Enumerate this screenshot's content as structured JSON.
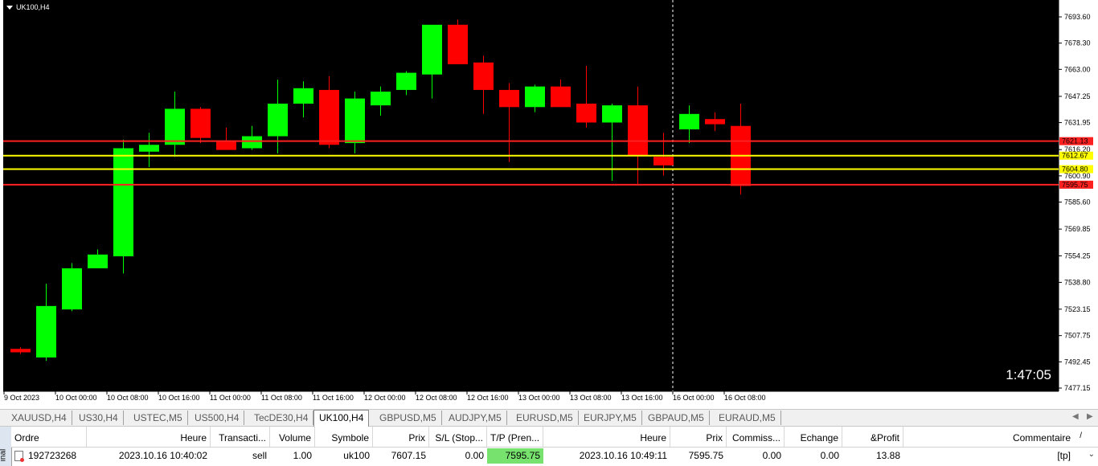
{
  "chart": {
    "symbol_timeframe": "UK100,H4",
    "countdown": "1:47:05",
    "colors": {
      "background": "#000000",
      "bull": "#00ff00",
      "bear": "#ff0000",
      "grid": "#ffffff",
      "level_red": "#ff2020",
      "level_yellow": "#ffff00"
    },
    "price_axis": [
      "7693.60",
      "7678.30",
      "7663.00",
      "7647.25",
      "7631.95",
      "7616.20",
      "7600.90",
      "7585.60",
      "7569.85",
      "7554.25",
      "7538.80",
      "7523.15",
      "7507.75",
      "7492.45",
      "7477.15"
    ],
    "time_axis": [
      "9 Oct 2023",
      "10 Oct 00:00",
      "10 Oct 08:00",
      "10 Oct 16:00",
      "11 Oct 00:00",
      "11 Oct 08:00",
      "11 Oct 16:00",
      "12 Oct 00:00",
      "12 Oct 08:00",
      "12 Oct 16:00",
      "13 Oct 00:00",
      "13 Oct 08:00",
      "13 Oct 16:00",
      "16 Oct 00:00",
      "16 Oct 08:00"
    ],
    "levels": [
      {
        "price": 7621.13,
        "label": "7621.13",
        "color": "#ff2020"
      },
      {
        "price": 7612.67,
        "label": "7612.67",
        "color": "#ffff00"
      },
      {
        "price": 7604.8,
        "label": "7604.80",
        "color": "#ffff00"
      },
      {
        "price": 7595.75,
        "label": "7595.75",
        "color": "#ff2020"
      }
    ],
    "candles": [
      {
        "o": 7500,
        "h": 7501,
        "c": 7498,
        "l": 7497
      },
      {
        "o": 7495,
        "h": 7538,
        "c": 7525,
        "l": 7493
      },
      {
        "o": 7523,
        "h": 7550,
        "c": 7547,
        "l": 7522
      },
      {
        "o": 7547,
        "h": 7558,
        "c": 7555,
        "l": 7547
      },
      {
        "o": 7554,
        "h": 7622,
        "c": 7617,
        "l": 7544
      },
      {
        "o": 7615,
        "h": 7626,
        "c": 7619,
        "l": 7606
      },
      {
        "o": 7619,
        "h": 7650,
        "c": 7640,
        "l": 7612
      },
      {
        "o": 7640,
        "h": 7641,
        "c": 7623,
        "l": 7620
      },
      {
        "o": 7621,
        "h": 7629,
        "c": 7616,
        "l": 7616
      },
      {
        "o": 7617,
        "h": 7630,
        "c": 7624,
        "l": 7616
      },
      {
        "o": 7624,
        "h": 7657,
        "c": 7643,
        "l": 7614
      },
      {
        "o": 7643,
        "h": 7656,
        "c": 7652,
        "l": 7635
      },
      {
        "o": 7651,
        "h": 7659,
        "c": 7619,
        "l": 7617
      },
      {
        "o": 7620,
        "h": 7650,
        "c": 7646,
        "l": 7614
      },
      {
        "o": 7642,
        "h": 7653,
        "c": 7650,
        "l": 7636
      },
      {
        "o": 7651,
        "h": 7662,
        "c": 7661,
        "l": 7648
      },
      {
        "o": 7660,
        "h": 7681,
        "c": 7689,
        "l": 7646
      },
      {
        "o": 7689,
        "h": 7692,
        "c": 7666,
        "l": 7666
      },
      {
        "o": 7667,
        "h": 7671,
        "c": 7651,
        "l": 7637
      },
      {
        "o": 7651,
        "h": 7655,
        "c": 7641,
        "l": 7609
      },
      {
        "o": 7641,
        "h": 7654,
        "c": 7653,
        "l": 7638
      },
      {
        "o": 7653,
        "h": 7657,
        "c": 7641,
        "l": 7641
      },
      {
        "o": 7643,
        "h": 7665,
        "c": 7632,
        "l": 7629
      },
      {
        "o": 7632,
        "h": 7643,
        "c": 7642,
        "l": 7598
      },
      {
        "o": 7642,
        "h": 7653,
        "c": 7613,
        "l": 7596
      },
      {
        "o": 7612,
        "h": 7626,
        "c": 7607,
        "l": 7601
      },
      {
        "o": 7628,
        "h": 7642,
        "c": 7637,
        "l": 7620
      },
      {
        "o": 7634,
        "h": 7638,
        "c": 7631,
        "l": 7627
      },
      {
        "o": 7630,
        "h": 7643,
        "c": 7595,
        "l": 7590
      }
    ]
  },
  "tabs": [
    "XAUUSD,H4",
    "US30,H4",
    "USTEC,M5",
    "US500,H4",
    "TecDE30,H4",
    "UK100,H4",
    "GBPUSD,M5",
    "AUDJPY,M5",
    "EURUSD,M5",
    "EURJPY,M5",
    "GBPAUD,M5",
    "EURAUD,M5"
  ],
  "active_tab": "UK100,H4",
  "terminal": {
    "side_label": "inal",
    "headers": [
      "Ordre",
      "Heure",
      "Transacti...",
      "Volume",
      "Symbole",
      "Prix",
      "S/L (Stop...",
      "T/P (Pren...",
      "Heure",
      "Prix",
      "Commiss...",
      "Echange",
      "&Profit",
      "Commentaire"
    ],
    "row": [
      "192723268",
      "2023.10.16 10:40:02",
      "sell",
      "1.00",
      "uk100",
      "7607.15",
      "0.00",
      "7595.75",
      "2023.10.16 10:49:11",
      "7595.75",
      "0.00",
      "0.00",
      "13.88",
      "[tp]"
    ]
  }
}
